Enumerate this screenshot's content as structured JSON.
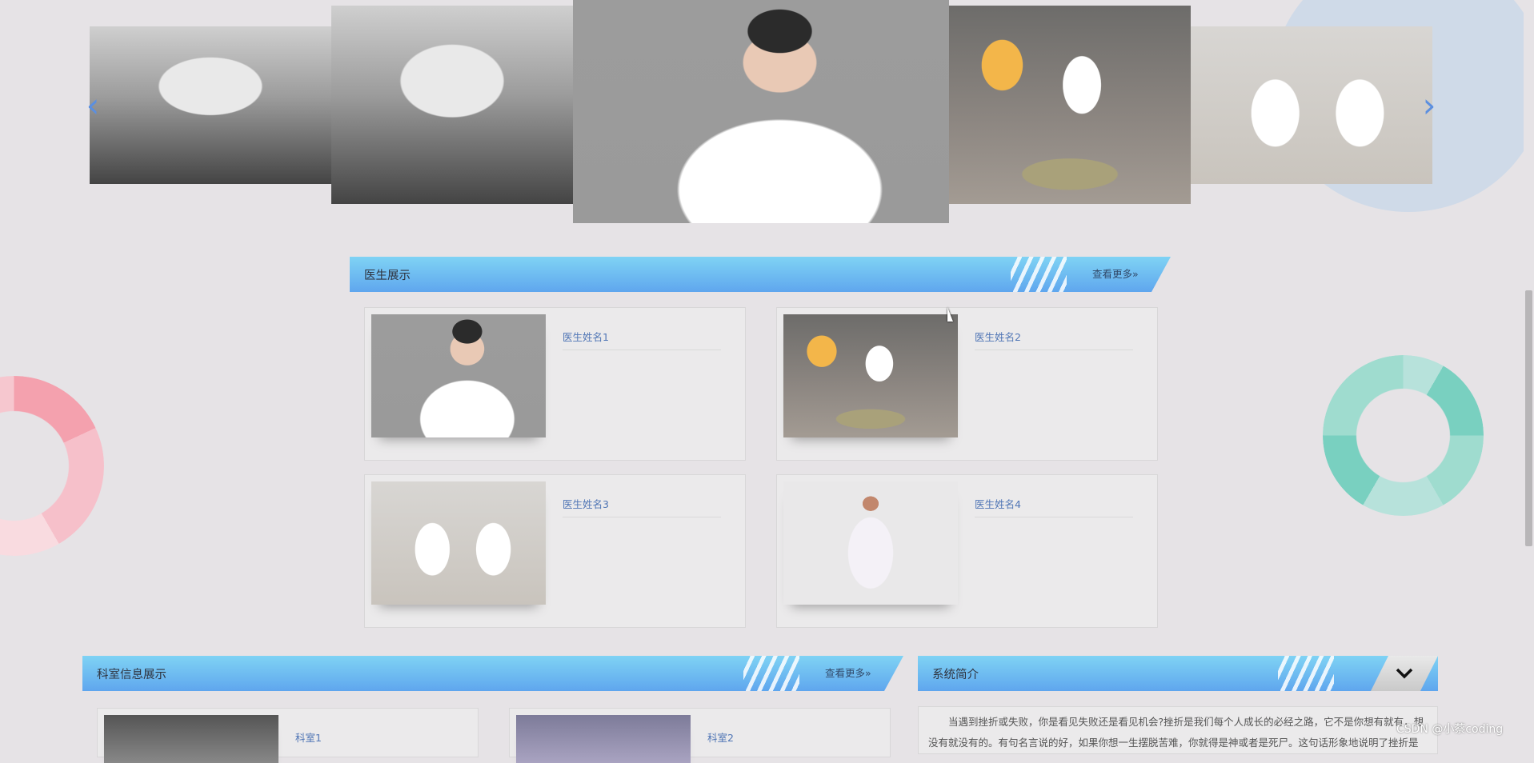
{
  "carousel": {
    "prev_icon": "chevron-left-icon",
    "next_icon": "chevron-right-icon",
    "prev_symbol": "‹",
    "next_symbol": "›"
  },
  "doctors_section": {
    "title": "医生展示",
    "more_label": "查看更多»",
    "cards": [
      {
        "name": "医生姓名1"
      },
      {
        "name": "医生姓名2"
      },
      {
        "name": "医生姓名3"
      },
      {
        "name": "医生姓名4"
      }
    ]
  },
  "departments_section": {
    "title": "科室信息展示",
    "more_label": "查看更多»",
    "cards": [
      {
        "name": "科室1"
      },
      {
        "name": "科室2"
      }
    ]
  },
  "system_intro_section": {
    "title": "系统简介",
    "toggle_icon": "chevron-down-icon",
    "text": "当遇到挫折或失败，你是看见失败还是看见机会?挫折是我们每个人成长的必经之路，它不是你想有就有，想没有就没有的。有句名言说的好，如果你想一生摆脱苦难，你就得是神或者是死尸。这句话形象地说明了挫折是伴"
  },
  "watermark": "CSDN @小蔡coding",
  "colors": {
    "background": "#e6e3e6",
    "header_gradient_top": "#7fd3f4",
    "header_gradient_bottom": "#5fa6ee",
    "link": "#4f75b5"
  }
}
